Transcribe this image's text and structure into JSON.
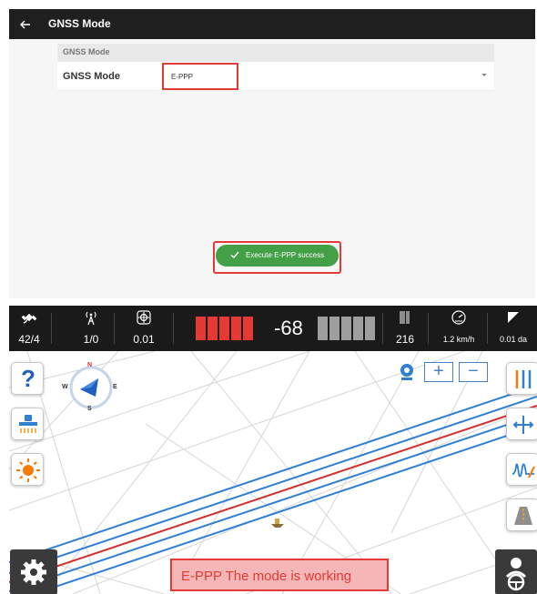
{
  "gnss_screen": {
    "title": "GNSS Mode",
    "section_title": "GNSS Mode",
    "mode_label": "GNSS Mode",
    "mode_value": "E-PPP",
    "toast": "Execute E-PPP success"
  },
  "status_bar": {
    "satellites": "42/4",
    "base": "1/0",
    "accuracy": "0.01",
    "offset": "-68",
    "lines": "216",
    "speed": "1.2 km/h",
    "area": "0.01 da"
  },
  "map": {
    "compass": {
      "n": "N",
      "s": "S",
      "e": "E",
      "w": "W"
    },
    "zoom_in": "+",
    "zoom_out": "−",
    "help": "?",
    "status_message": "E-PPP The mode is working"
  },
  "colors": {
    "accent_red": "#e53935",
    "success_green": "#43a047",
    "guideline_blue": "#2f7fd4",
    "guideline_red": "#d32f2f",
    "header_dark": "#1f1f1f"
  },
  "icons": [
    "back-arrow-icon",
    "check-icon",
    "satellite-icon",
    "antenna-icon",
    "target-icon",
    "barcode-icon",
    "speedometer-icon",
    "area-icon",
    "help-icon",
    "equipment-icon",
    "sun-icon",
    "compass-icon",
    "camera-icon",
    "sliders-icon",
    "move-icon",
    "wave-icon",
    "road-icon",
    "gear-icon",
    "driver-icon"
  ]
}
